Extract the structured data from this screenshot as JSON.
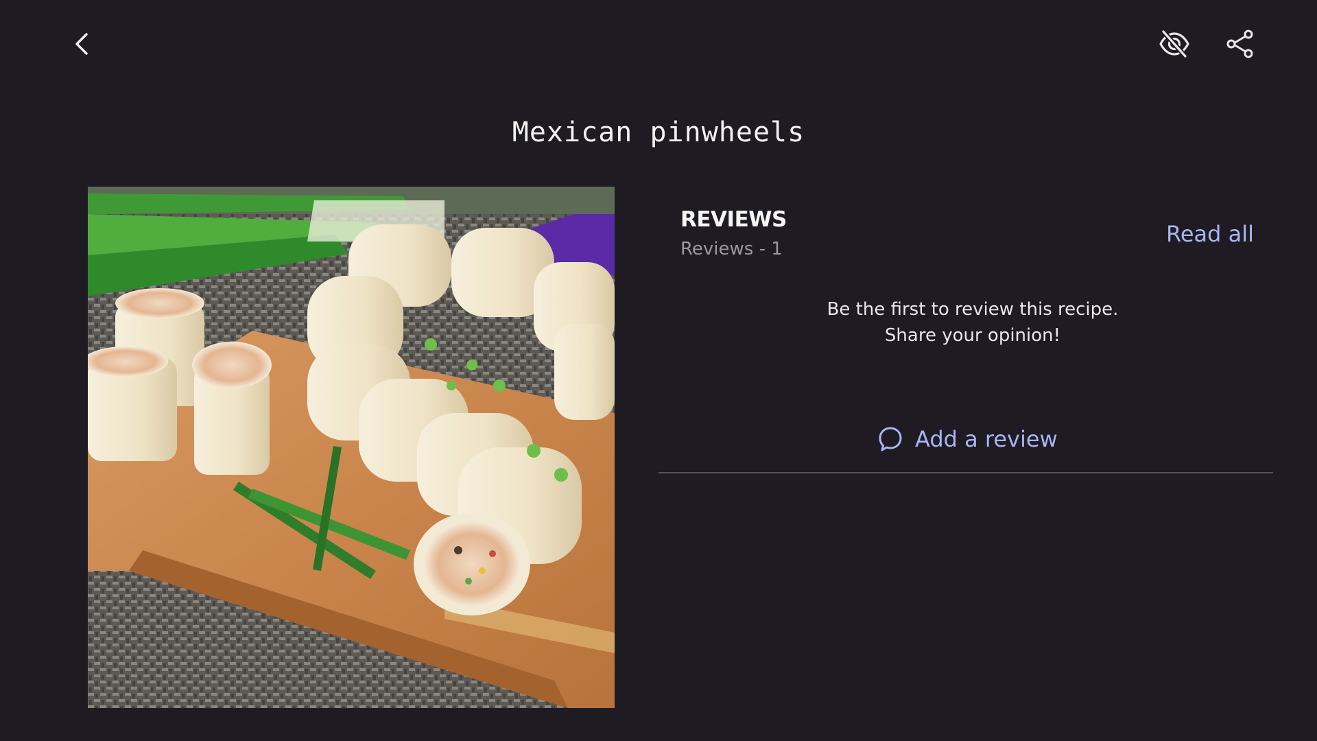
{
  "header": {
    "back_icon": "chevron-left-icon",
    "hide_icon": "eye-off-icon",
    "share_icon": "share-icon"
  },
  "recipe": {
    "title": "Mexican pinwheels"
  },
  "reviews": {
    "heading": "REVIEWS",
    "count_label": "Reviews - 1",
    "read_all_label": "Read all",
    "empty_message": "Be the first to review this recipe. Share your opinion!",
    "add_review_label": "Add a review",
    "add_review_icon": "comment-bubble-icon"
  },
  "colors": {
    "background": "#1e1c22",
    "accent": "#a9b5f4",
    "muted_text": "#9a979e",
    "divider": "#55535a"
  }
}
